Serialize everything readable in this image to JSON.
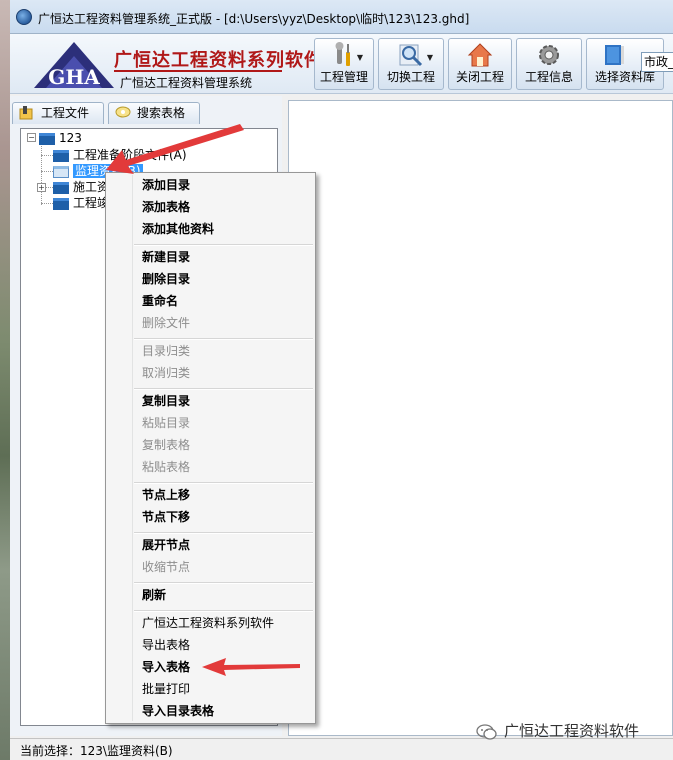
{
  "window": {
    "title": "广恒达工程资料管理系统_正式版 - [d:\\Users\\yyz\\Desktop\\临时\\123\\123.ghd]"
  },
  "brand": {
    "logo_icon": "gha-logo",
    "main": "广恒达工程资料系列软件",
    "sub": "广恒达工程资料管理系统",
    "accent_color": "#b01818"
  },
  "toolbar": {
    "buttons": [
      {
        "label": "工程管理",
        "icon": "wrench-screwdriver-icon",
        "has_dropdown": true
      },
      {
        "label": "切换工程",
        "icon": "magnifier-icon",
        "has_dropdown": true
      },
      {
        "label": "关闭工程",
        "icon": "house-icon",
        "has_dropdown": false
      },
      {
        "label": "工程信息",
        "icon": "gear-icon",
        "has_dropdown": false
      },
      {
        "label": "选择资料库",
        "icon": "book-icon",
        "has_dropdown": false
      }
    ],
    "combo_value": "市政_"
  },
  "tabs": [
    {
      "label": "工程文件",
      "icon": "folder-bookmark-icon"
    },
    {
      "label": "搜索表格",
      "icon": "search-bubble-icon"
    }
  ],
  "tree": {
    "root": "123",
    "children": [
      {
        "label": "工程准备阶段文件(A)"
      },
      {
        "label": "监理资料(B)"
      },
      {
        "label": "施工资"
      },
      {
        "label": "工程竣"
      }
    ]
  },
  "context_menu": {
    "items": [
      {
        "label": "添加目录",
        "state": "bold"
      },
      {
        "label": "添加表格",
        "state": "bold"
      },
      {
        "label": "添加其他资料",
        "state": "bold"
      },
      {
        "label": "新建目录",
        "state": "bold"
      },
      {
        "label": "删除目录",
        "state": "bold"
      },
      {
        "label": "重命名",
        "state": "bold"
      },
      {
        "label": "删除文件",
        "state": "disabled"
      },
      {
        "label": "目录归类",
        "state": "disabled"
      },
      {
        "label": "取消归类",
        "state": "disabled"
      },
      {
        "label": "复制目录",
        "state": "bold"
      },
      {
        "label": "粘贴目录",
        "state": "disabled"
      },
      {
        "label": "复制表格",
        "state": "disabled"
      },
      {
        "label": "粘贴表格",
        "state": "disabled"
      },
      {
        "label": "节点上移",
        "state": "bold"
      },
      {
        "label": "节点下移",
        "state": "bold"
      },
      {
        "label": "展开节点",
        "state": "bold"
      },
      {
        "label": "收缩节点",
        "state": "disabled"
      },
      {
        "label": "刷新",
        "state": "bold"
      },
      {
        "label": "广恒达工程资料系列软件",
        "state": "normal"
      },
      {
        "label": "导出表格",
        "state": "normal"
      },
      {
        "label": "导入表格",
        "state": "bold"
      },
      {
        "label": "批量打印",
        "state": "normal"
      },
      {
        "label": "导入目录表格",
        "state": "bold"
      }
    ]
  },
  "status": {
    "text": "当前选择：123\\监理资料(B)"
  },
  "watermark": {
    "text": "广恒达工程资料软件",
    "icon": "wechat-icon"
  },
  "annotation_color": "#e23a3a"
}
